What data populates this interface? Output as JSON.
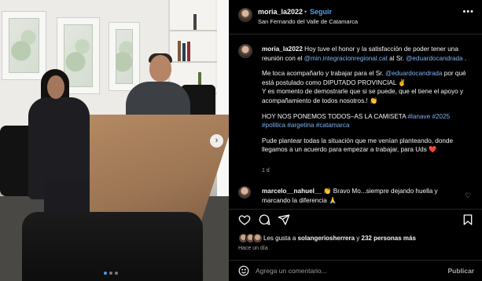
{
  "post": {
    "username": "moria_la2022",
    "separator": "•",
    "follow_label": "Seguir",
    "location": "San Fernando del Valle de Catamarca",
    "more_icon": "more-horizontal-icon"
  },
  "caption": {
    "username": "moria_la2022",
    "line1_a": " Hoy tuve el honor y la satisfacción de poder tener una reunión con el ",
    "mention1": "@min.integracionregional.cat",
    "line1_b": " al Sr. ",
    "mention2": "@eduardocandrada",
    "line1_c": " .",
    "para2_a": "Me toca acompañarlo y trabajar para el Sr. ",
    "mention3": "@eduardocandrada",
    "para2_b": " por qué está postulado como DIPUTADO PROVINCIAL ✌️",
    "para2_c": "Y es momento de demostrarle que si se puede, que el tiene el apoyo y acompañamiento de todos nosotros.! 👏",
    "para3_a": "HOY NOS PONEMOS TODOS–AS LA CAMISETA ",
    "tag1": "#lanave",
    "tag2": "#2025",
    "tag3": "#politica",
    "tag4": "#argetina",
    "tag5": "#catamarca",
    "para4": "Pude plantear todas la situación que me venían planteando, donde llegamos a un acuerdo para empezar a trabajar, para Uds ❤️",
    "age": "1 d"
  },
  "reply": {
    "username": "marcelo__nahuel__",
    "text": " 👏 Bravo Mo...siempre dejando huella y marcando la diferencia 🙏"
  },
  "actions": {
    "like_icon": "heart-icon",
    "comment_icon": "comment-icon",
    "share_icon": "share-icon",
    "save_icon": "bookmark-icon"
  },
  "likes": {
    "prefix": "Les gusta a ",
    "user": "solangeriosherrera",
    "middle": " y ",
    "count": "232 personas más"
  },
  "time_ago": "Hace un día",
  "comment_box": {
    "placeholder": "Agrega un comentario...",
    "publish_label": "Publicar"
  },
  "carousel": {
    "total": 3,
    "active_index": 0
  }
}
